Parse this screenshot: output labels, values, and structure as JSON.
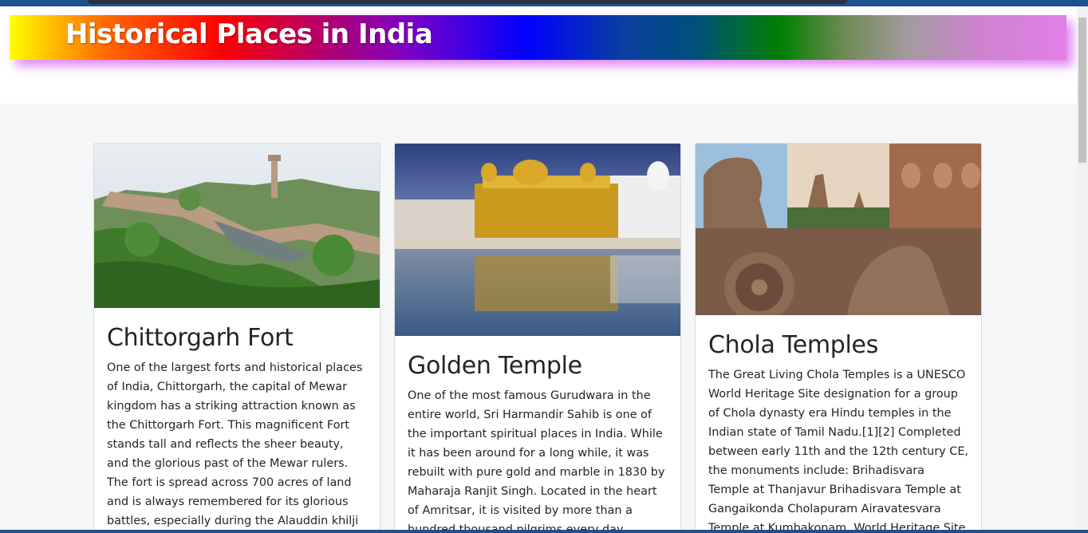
{
  "page": {
    "title": "Historical Places in India"
  },
  "cards": [
    {
      "title": "Chittorgarh Fort",
      "text": "One of the largest forts and historical places of India, Chittorgarh, the capital of Mewar kingdom has a striking attraction known as the Chittorgarh Fort. This magnificent Fort stands tall and reflects the sheer beauty, and the glorious past of the Mewar rulers. The fort is spread across 700 acres of land and is always remembered for its glorious battles, especially during the Alauddin khilji and self-"
    },
    {
      "title": "Golden Temple",
      "text": "One of the most famous Gurudwara in the entire world, Sri Harmandir Sahib is one of the important spiritual places in India. While it has been around for a long while, it was rebuilt with pure gold and marble in 1830 by Maharaja Ranjit Singh. Located in the heart of Amritsar, it is visited by more than a hundred thousand pilgrims every day."
    },
    {
      "title": "Chola Temples",
      "text": "The Great Living Chola Temples is a UNESCO World Heritage Site designation for a group of Chola dynasty era Hindu temples in the Indian state of Tamil Nadu.[1][2] Completed between early 11th and the 12th century CE, the monuments include: Brihadisvara Temple at Thanjavur Brihadisvara Temple at Gangaikonda Cholapuram Airavatesvara Temple at Kumbakonam. World Heritage Site"
    }
  ]
}
